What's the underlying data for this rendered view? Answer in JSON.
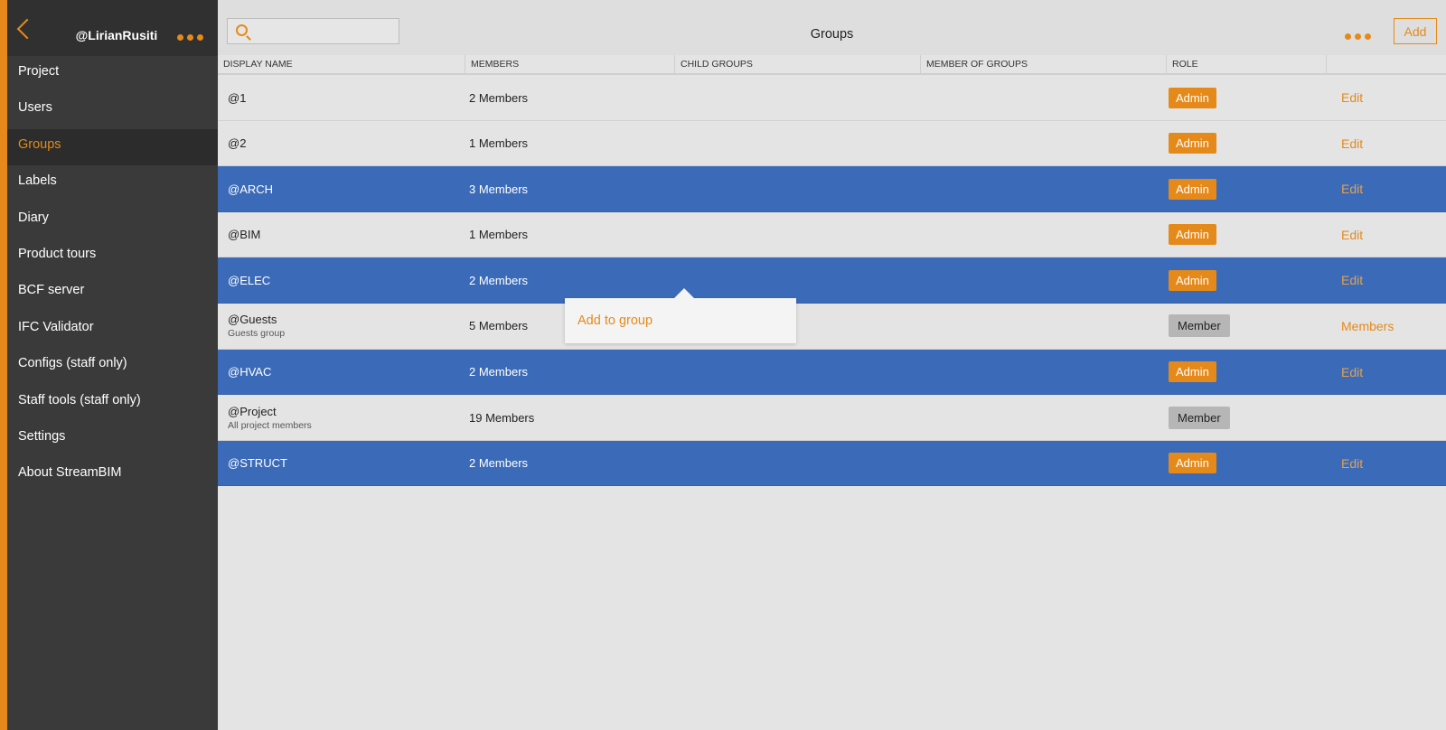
{
  "sidebar": {
    "user": "@LirianRusiti",
    "items": [
      {
        "label": "Project"
      },
      {
        "label": "Users"
      },
      {
        "label": "Groups",
        "active": true
      },
      {
        "label": "Labels"
      },
      {
        "label": "Diary"
      },
      {
        "label": "Product tours"
      },
      {
        "label": "BCF server"
      },
      {
        "label": "IFC Validator"
      },
      {
        "label": "Configs (staff only)"
      },
      {
        "label": "Staff tools (staff only)"
      },
      {
        "label": "Settings"
      },
      {
        "label": "About StreamBIM"
      }
    ]
  },
  "header": {
    "title": "Groups",
    "search_value": "",
    "add_label": "Add"
  },
  "table": {
    "columns": [
      "DISPLAY NAME",
      "MEMBERS",
      "CHILD GROUPS",
      "MEMBER OF GROUPS",
      "ROLE"
    ],
    "rows": [
      {
        "name": "@1",
        "sub": "",
        "members": "2 Members",
        "role": "Admin",
        "action": "Edit",
        "selected": false
      },
      {
        "name": "@2",
        "sub": "",
        "members": "1 Members",
        "role": "Admin",
        "action": "Edit",
        "selected": false
      },
      {
        "name": "@ARCH",
        "sub": "",
        "members": "3 Members",
        "role": "Admin",
        "action": "Edit",
        "selected": true
      },
      {
        "name": "@BIM",
        "sub": "",
        "members": "1 Members",
        "role": "Admin",
        "action": "Edit",
        "selected": false
      },
      {
        "name": "@ELEC",
        "sub": "",
        "members": "2 Members",
        "role": "Admin",
        "action": "Edit",
        "selected": true
      },
      {
        "name": "@Guests",
        "sub": "Guests group",
        "members": "5 Members",
        "role": "Member",
        "action": "Members",
        "selected": false
      },
      {
        "name": "@HVAC",
        "sub": "",
        "members": "2 Members",
        "role": "Admin",
        "action": "Edit",
        "selected": true
      },
      {
        "name": "@Project",
        "sub": "All project members",
        "members": "19 Members",
        "role": "Member",
        "action": "",
        "selected": false
      },
      {
        "name": "@STRUCT",
        "sub": "",
        "members": "2 Members",
        "role": "Admin",
        "action": "Edit",
        "selected": true
      }
    ]
  },
  "popover": {
    "item": "Add to group"
  },
  "colors": {
    "accent": "#e58a1a",
    "selected_row": "#3b6bb8",
    "sidebar_bg": "#3a3a3a"
  }
}
